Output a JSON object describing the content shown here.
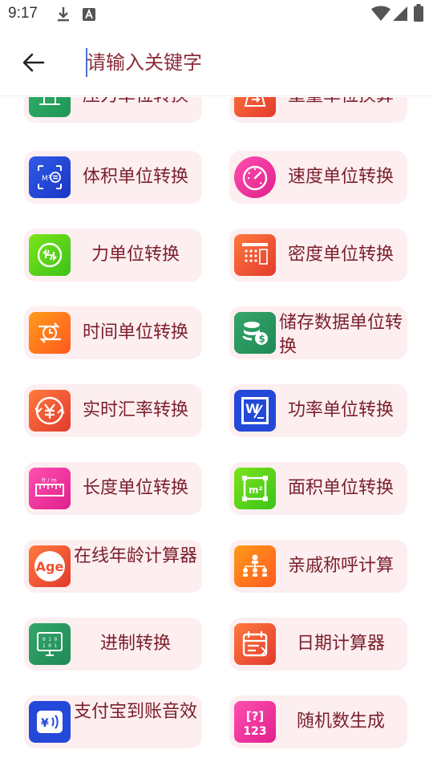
{
  "status_bar": {
    "time": "9:17"
  },
  "search": {
    "placeholder": "请输入关键字"
  },
  "items": [
    {
      "label": "压力单位转换",
      "icon": "pressure-gauge-icon",
      "color": "#2fae68"
    },
    {
      "label": "重量单位换算",
      "icon": "weight-scale-icon",
      "color": "#f0502e"
    },
    {
      "label": "体积单位转换",
      "icon": "volume-cube-icon",
      "color": "#2448d8"
    },
    {
      "label": "速度单位转换",
      "icon": "speedometer-icon",
      "color": "#f0309a"
    },
    {
      "label": "力单位转换",
      "icon": "force-icon",
      "color": "#5cd11a"
    },
    {
      "label": "密度单位转换",
      "icon": "density-grid-icon",
      "color": "#f0502e"
    },
    {
      "label": "时间单位转换",
      "icon": "clock-exchange-icon",
      "color": "#ff7a1f"
    },
    {
      "label": "储存数据单位转换",
      "icon": "database-coin-icon",
      "color": "#2e9e5e"
    },
    {
      "label": "实时汇率转换",
      "icon": "yen-exchange-icon",
      "color": "#f24a2a"
    },
    {
      "label": "功率单位转换",
      "icon": "power-watt-icon",
      "color": "#2448d8"
    },
    {
      "label": "长度单位转换",
      "icon": "ruler-icon",
      "color": "#f0309a"
    },
    {
      "label": "面积单位转换",
      "icon": "area-square-icon",
      "color": "#4ccc1a"
    },
    {
      "label": "在线年龄计算器",
      "icon": "age-icon",
      "color": "#f0502e"
    },
    {
      "label": "亲戚称呼计算",
      "icon": "family-tree-icon",
      "color": "#ff7a1f"
    },
    {
      "label": "进制转换",
      "icon": "binary-monitor-icon",
      "color": "#2e9e5e"
    },
    {
      "label": "日期计算器",
      "icon": "calendar-icon",
      "color": "#f0502e"
    },
    {
      "label": "支付宝到账音效",
      "icon": "alipay-sound-icon",
      "color": "#2448d8"
    },
    {
      "label": "随机数生成",
      "icon": "random-number-icon",
      "color": "#f0309a"
    }
  ],
  "icon_texts": {
    "age": "Age",
    "random_top": "[?]",
    "random_bottom": "123",
    "watt": "W"
  }
}
